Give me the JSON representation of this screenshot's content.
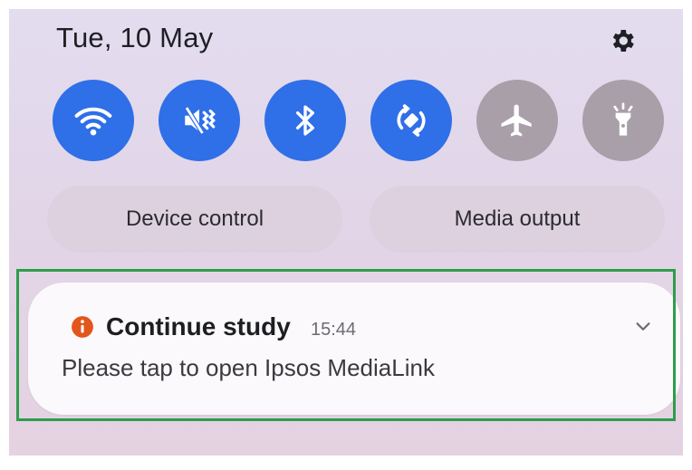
{
  "header": {
    "date": "Tue, 10 May",
    "settings_icon": "gear-icon"
  },
  "quick_toggles": [
    {
      "name": "Wi-Fi",
      "icon": "wifi-icon",
      "state": "on"
    },
    {
      "name": "Sound",
      "icon": "mute-vibrate-icon",
      "state": "on"
    },
    {
      "name": "Bluetooth",
      "icon": "bluetooth-icon",
      "state": "on"
    },
    {
      "name": "Auto rotate",
      "icon": "auto-rotate-icon",
      "state": "on"
    },
    {
      "name": "Airplane mode",
      "icon": "airplane-icon",
      "state": "off"
    },
    {
      "name": "Flashlight",
      "icon": "flashlight-icon",
      "state": "off"
    }
  ],
  "actions": {
    "device_control": "Device control",
    "media_output": "Media output"
  },
  "notification": {
    "icon": "info-icon",
    "title": "Continue study",
    "time": "15:44",
    "body": "Please tap to open Ipsos MediaLink",
    "expand_icon": "chevron-down-icon"
  },
  "colors": {
    "toggle_on": "#2f6fe8",
    "toggle_off": "#a89fa8",
    "highlight_border": "#2e9d4c",
    "info_icon": "#e2561b"
  }
}
